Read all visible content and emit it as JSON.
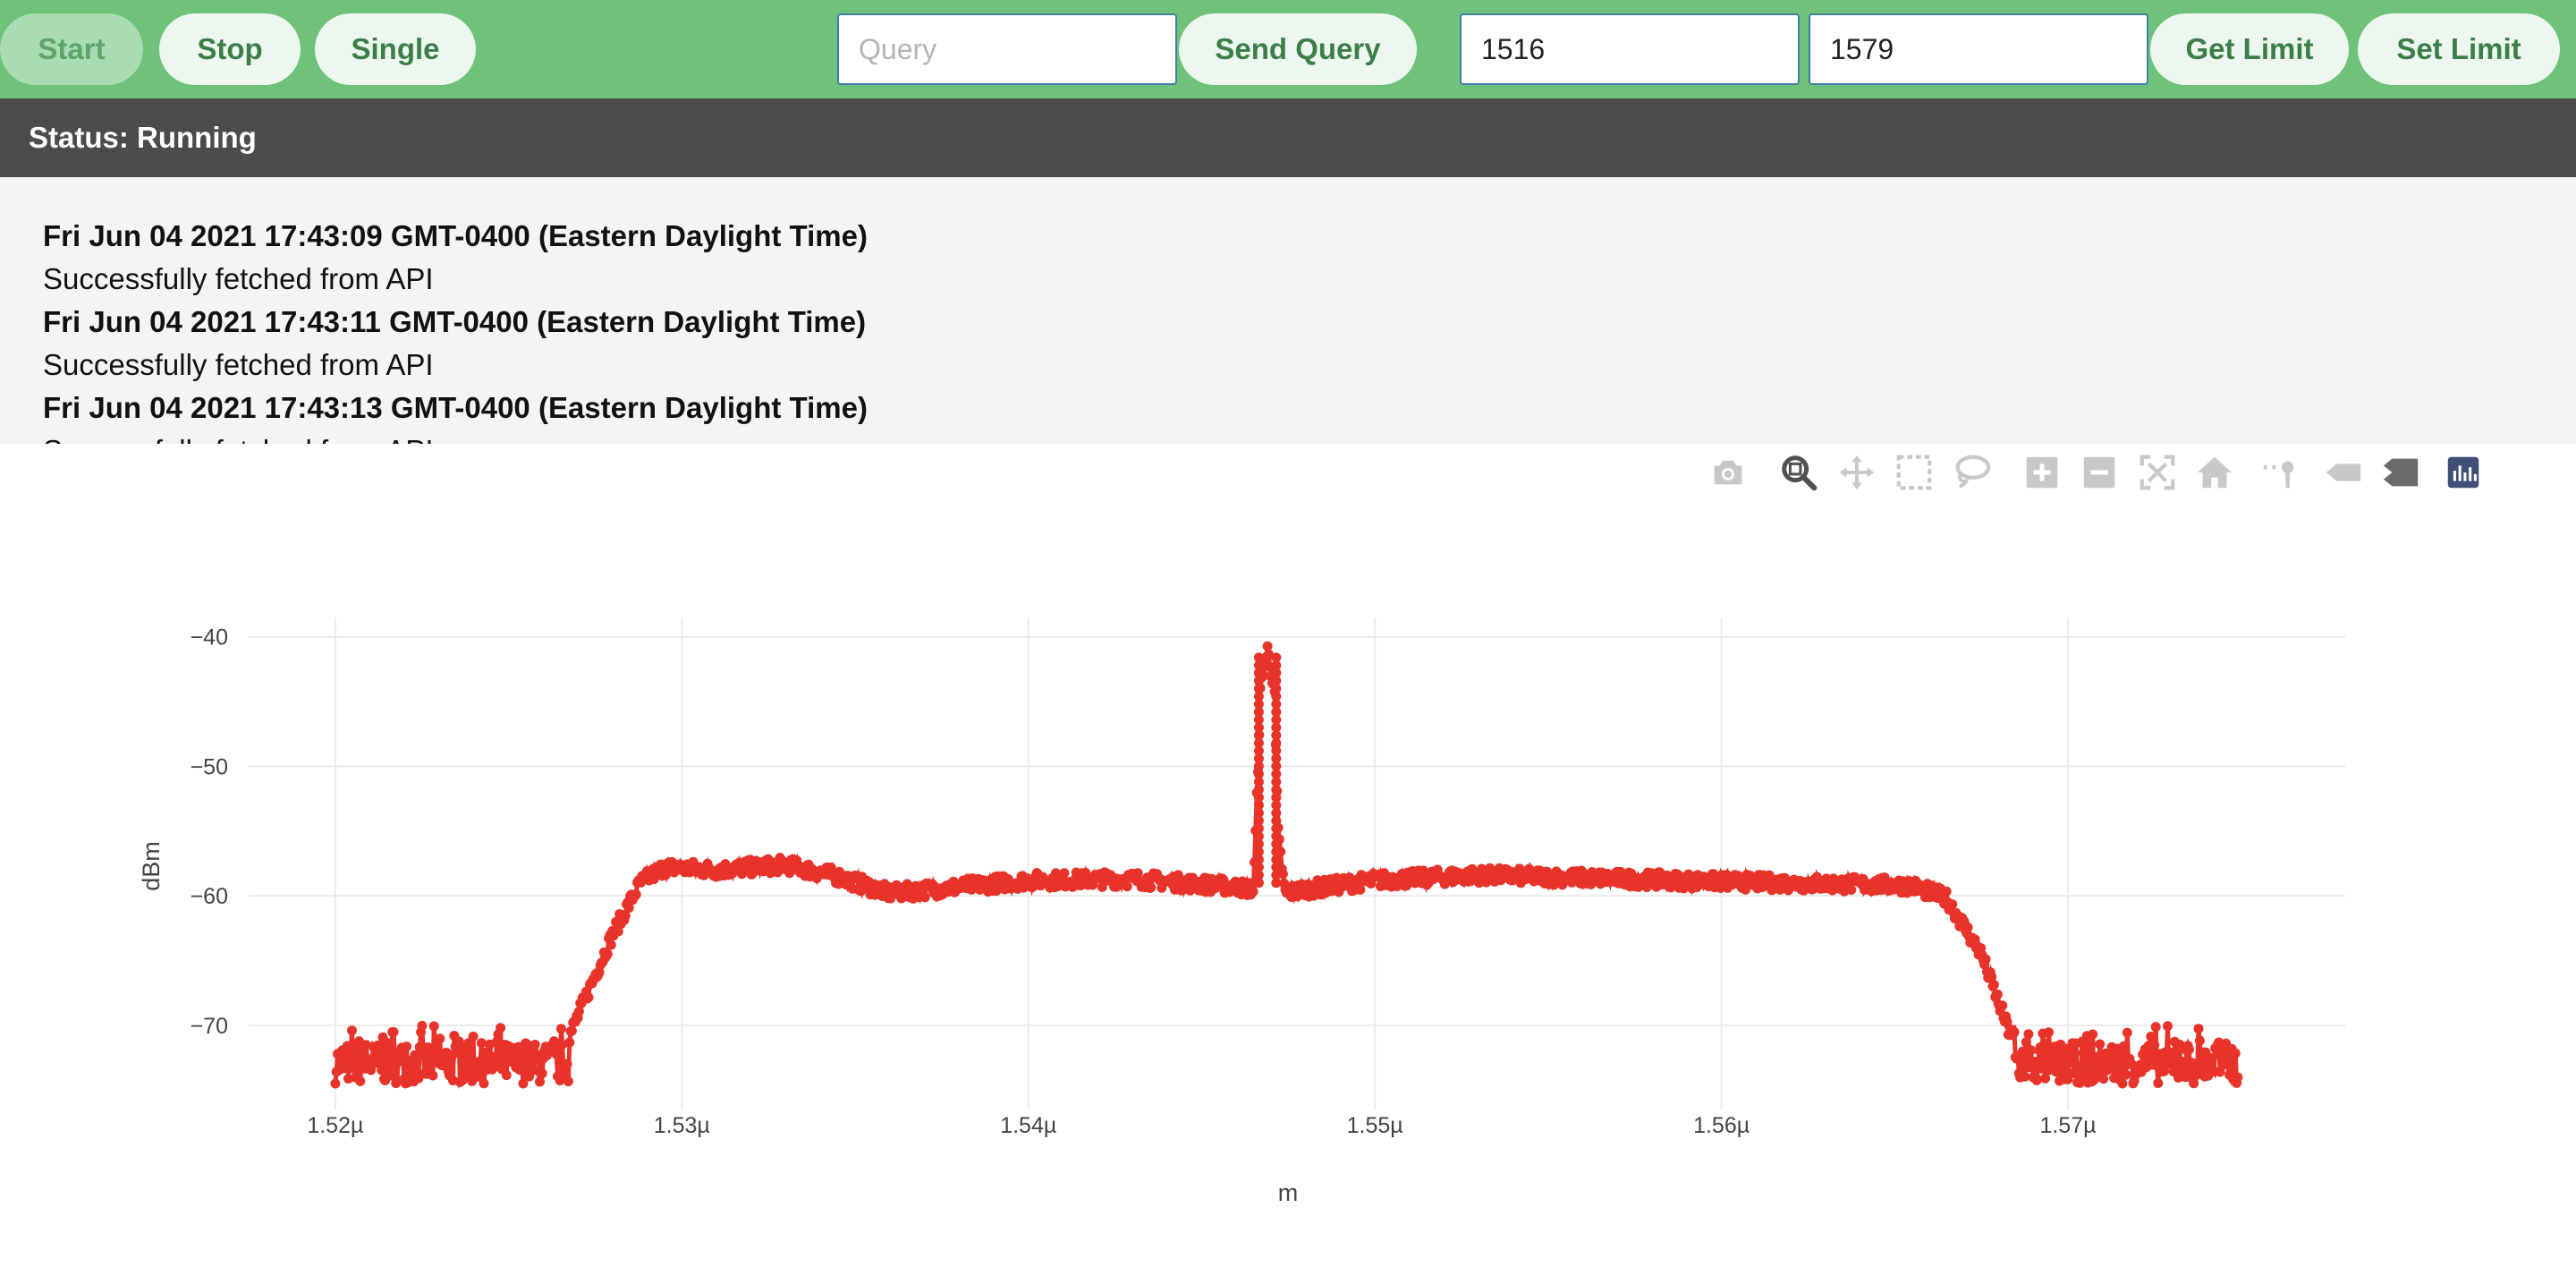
{
  "toolbar": {
    "start_label": "Start",
    "stop_label": "Stop",
    "single_label": "Single",
    "query_placeholder": "Query",
    "query_value": "",
    "send_query_label": "Send Query",
    "limit_low": "1516",
    "limit_high": "1579",
    "get_limit_label": "Get Limit",
    "set_limit_label": "Set Limit"
  },
  "status": {
    "text": "Status: Running"
  },
  "log": {
    "entries": [
      {
        "time": "Fri Jun 04 2021 17:43:09 GMT-0400 (Eastern Daylight Time)",
        "message": "Successfully fetched from API"
      },
      {
        "time": "Fri Jun 04 2021 17:43:11 GMT-0400 (Eastern Daylight Time)",
        "message": "Successfully fetched from API"
      },
      {
        "time": "Fri Jun 04 2021 17:43:13 GMT-0400 (Eastern Daylight Time)",
        "message": "Successfully fetched from API"
      }
    ]
  },
  "modebar": {
    "icons": [
      "camera-icon",
      "zoom-icon",
      "pan-icon",
      "box-select-icon",
      "lasso-select-icon",
      "zoom-in-icon",
      "zoom-out-icon",
      "autoscale-icon",
      "reset-axes-icon",
      "spike-lines-icon",
      "hover-closest-icon",
      "hover-compare-icon",
      "plotly-logo-icon"
    ]
  },
  "colors": {
    "toolbar_bg": "#6ec27a",
    "button_text": "#3b7f47",
    "status_bg": "#4b4b4b",
    "log_bg": "#f4f4f4",
    "trace": "#e8332a"
  },
  "chart_data": {
    "type": "scatter",
    "mode": "lines+markers",
    "title": "",
    "xlabel": "m",
    "ylabel": "dBm",
    "xlim": [
      1.5175e-06,
      1.578e-06
    ],
    "ylim": [
      -76.5,
      -38.5
    ],
    "x_ticks": [
      1.52e-06,
      1.53e-06,
      1.54e-06,
      1.55e-06,
      1.56e-06,
      1.57e-06
    ],
    "x_tick_labels": [
      "1.52µ",
      "1.53µ",
      "1.54µ",
      "1.55µ",
      "1.56µ",
      "1.57µ"
    ],
    "y_ticks": [
      -40,
      -50,
      -60,
      -70
    ],
    "y_tick_labels": [
      "−40",
      "−50",
      "−60",
      "−70"
    ],
    "grid": true,
    "series": [
      {
        "color": "#e8332a",
        "x_range": [
          1.52e-06,
          1.5749e-06
        ],
        "noise_floor": [
          -74.5,
          -70
        ],
        "profile": [
          [
            1.52e-06,
            -72.5
          ],
          [
            1.5265e-06,
            -72.5
          ],
          [
            1.5272e-06,
            -68
          ],
          [
            1.528e-06,
            -63
          ],
          [
            1.5288e-06,
            -59
          ],
          [
            1.5295e-06,
            -57.8
          ],
          [
            1.531e-06,
            -58.0
          ],
          [
            1.533e-06,
            -57.6
          ],
          [
            1.5345e-06,
            -58.5
          ],
          [
            1.536e-06,
            -59.8
          ],
          [
            1.54e-06,
            -58.8
          ],
          [
            1.543e-06,
            -58.7
          ],
          [
            1.546e-06,
            -59.3
          ],
          [
            1.5465e-06,
            -59.5
          ],
          [
            1.5466e-06,
            -52
          ],
          [
            1.5467e-06,
            -44
          ],
          [
            1.5469e-06,
            -41.0
          ],
          [
            1.5471e-06,
            -44
          ],
          [
            1.5472e-06,
            -55
          ],
          [
            1.5474e-06,
            -59.8
          ],
          [
            1.548e-06,
            -59.5
          ],
          [
            1.55e-06,
            -58.8
          ],
          [
            1.553e-06,
            -58.4
          ],
          [
            1.56e-06,
            -58.9
          ],
          [
            1.5655e-06,
            -59.2
          ],
          [
            1.5665e-06,
            -60.2
          ],
          [
            1.5675e-06,
            -64.5
          ],
          [
            1.5683e-06,
            -70.5
          ],
          [
            1.569e-06,
            -72.5
          ],
          [
            1.5749e-06,
            -72.5
          ]
        ]
      }
    ]
  }
}
